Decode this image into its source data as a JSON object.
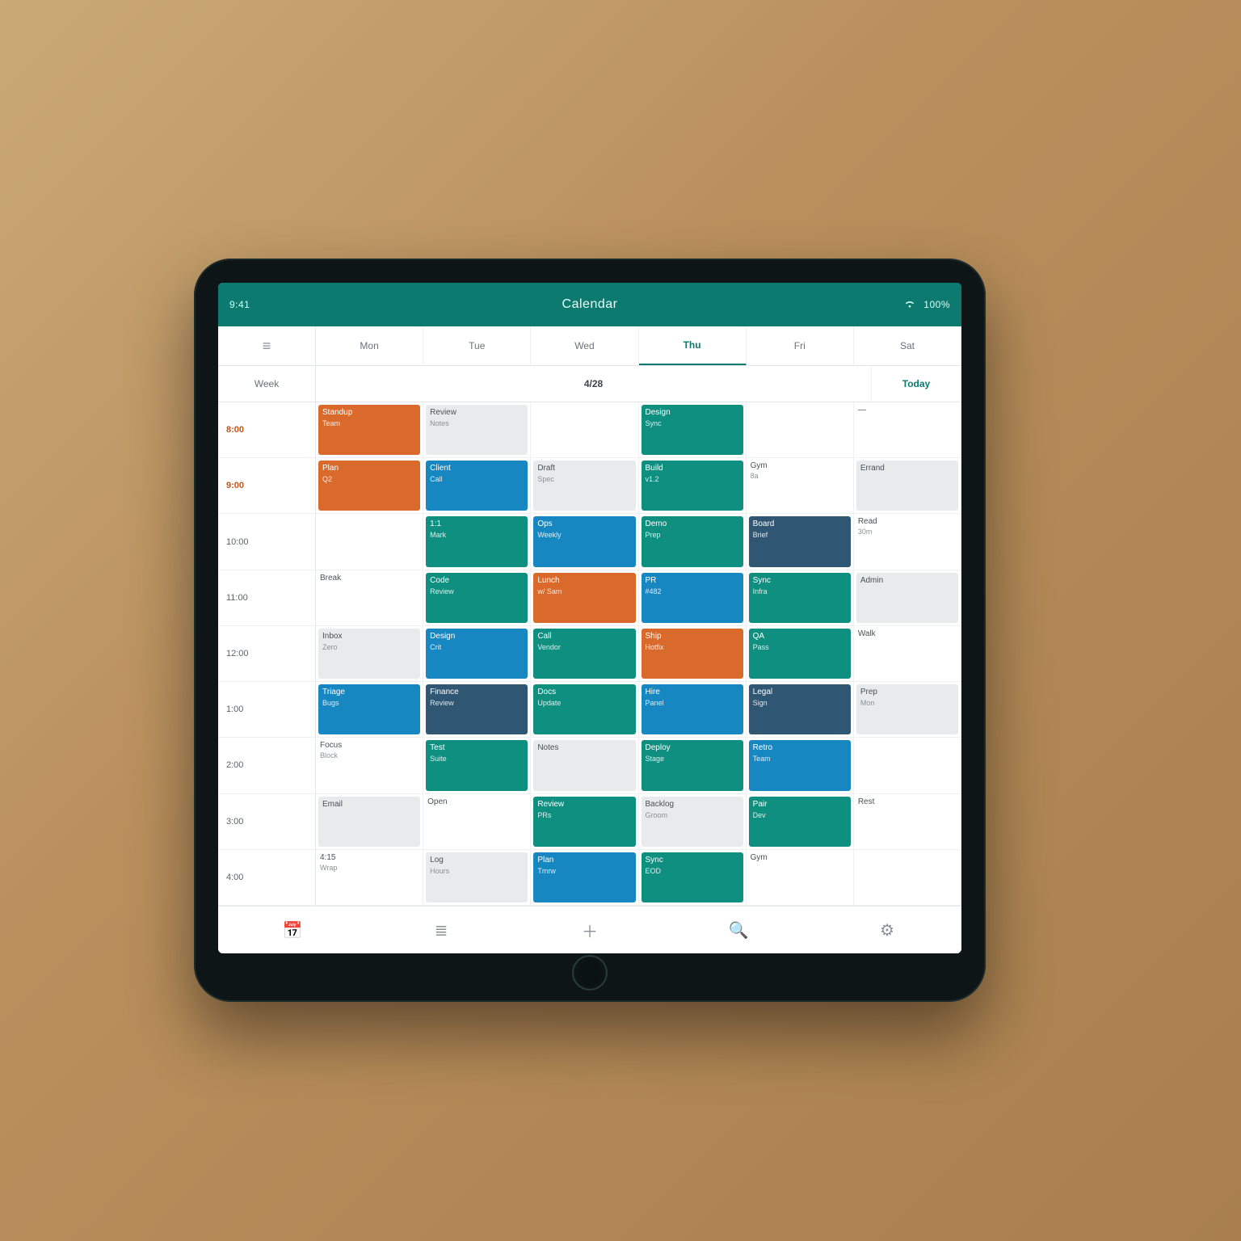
{
  "colors": {
    "teal": "#0f8f7f",
    "blue": "#1787c2",
    "navy": "#2f5672",
    "orange": "#d96a2b",
    "band": "#0c7a6e"
  },
  "titlebar": {
    "title": "Calendar",
    "time": "9:41",
    "battery": "100%"
  },
  "tabs": [
    {
      "label": "Mon"
    },
    {
      "label": "Tue"
    },
    {
      "label": "Wed"
    },
    {
      "label": "Thu"
    },
    {
      "label": "Fri"
    },
    {
      "label": "Sat"
    }
  ],
  "active_tab_index": 3,
  "inforow": {
    "left": "Week",
    "center": "4/28",
    "right": "Today"
  },
  "sidebar": {
    "items": [
      {
        "label": "8:00"
      },
      {
        "label": "9:00"
      },
      {
        "label": "10:00"
      },
      {
        "label": "11:00"
      },
      {
        "label": "12:00"
      },
      {
        "label": "1:00"
      },
      {
        "label": "2:00"
      },
      {
        "label": "3:00"
      },
      {
        "label": "4:00"
      }
    ]
  },
  "grid": {
    "cols": 6,
    "rows": 9,
    "cells": [
      [
        {
          "kind": "ev",
          "tone": "orange",
          "title": "Standup",
          "sub": "Team"
        },
        {
          "kind": "ev",
          "tone": "gray",
          "title": "Review",
          "sub": "Notes"
        },
        {
          "kind": "empty"
        },
        {
          "kind": "ev",
          "tone": "teal",
          "title": "Design",
          "sub": "Sync"
        },
        {
          "kind": "empty"
        },
        {
          "kind": "text",
          "title": "—",
          "sub": ""
        }
      ],
      [
        {
          "kind": "ev",
          "tone": "orange",
          "title": "Plan",
          "sub": "Q2"
        },
        {
          "kind": "ev",
          "tone": "blue",
          "title": "Client",
          "sub": "Call"
        },
        {
          "kind": "ev",
          "tone": "gray",
          "title": "Draft",
          "sub": "Spec"
        },
        {
          "kind": "ev",
          "tone": "teal",
          "title": "Build",
          "sub": "v1.2"
        },
        {
          "kind": "text",
          "title": "Gym",
          "sub": "8a"
        },
        {
          "kind": "ev",
          "tone": "gray",
          "title": "Errand",
          "sub": ""
        }
      ],
      [
        {
          "kind": "empty"
        },
        {
          "kind": "ev",
          "tone": "teal",
          "title": "1:1",
          "sub": "Mark"
        },
        {
          "kind": "ev",
          "tone": "blue",
          "title": "Ops",
          "sub": "Weekly"
        },
        {
          "kind": "ev",
          "tone": "teal",
          "title": "Demo",
          "sub": "Prep"
        },
        {
          "kind": "ev",
          "tone": "navy",
          "title": "Board",
          "sub": "Brief"
        },
        {
          "kind": "text",
          "title": "Read",
          "sub": "30m"
        }
      ],
      [
        {
          "kind": "text",
          "title": "Break",
          "sub": ""
        },
        {
          "kind": "ev",
          "tone": "teal",
          "title": "Code",
          "sub": "Review"
        },
        {
          "kind": "ev",
          "tone": "orange",
          "title": "Lunch",
          "sub": "w/ Sam"
        },
        {
          "kind": "ev",
          "tone": "blue",
          "title": "PR",
          "sub": "#482"
        },
        {
          "kind": "ev",
          "tone": "teal",
          "title": "Sync",
          "sub": "Infra"
        },
        {
          "kind": "ev",
          "tone": "gray",
          "title": "Admin",
          "sub": ""
        }
      ],
      [
        {
          "kind": "ev",
          "tone": "gray",
          "title": "Inbox",
          "sub": "Zero"
        },
        {
          "kind": "ev",
          "tone": "blue",
          "title": "Design",
          "sub": "Crit"
        },
        {
          "kind": "ev",
          "tone": "teal",
          "title": "Call",
          "sub": "Vendor"
        },
        {
          "kind": "ev",
          "tone": "orange",
          "title": "Ship",
          "sub": "Hotfix"
        },
        {
          "kind": "ev",
          "tone": "teal",
          "title": "QA",
          "sub": "Pass"
        },
        {
          "kind": "text",
          "title": "Walk",
          "sub": ""
        }
      ],
      [
        {
          "kind": "ev",
          "tone": "blue",
          "title": "Triage",
          "sub": "Bugs"
        },
        {
          "kind": "ev",
          "tone": "navy",
          "title": "Finance",
          "sub": "Review"
        },
        {
          "kind": "ev",
          "tone": "teal",
          "title": "Docs",
          "sub": "Update"
        },
        {
          "kind": "ev",
          "tone": "blue",
          "title": "Hire",
          "sub": "Panel"
        },
        {
          "kind": "ev",
          "tone": "navy",
          "title": "Legal",
          "sub": "Sign"
        },
        {
          "kind": "ev",
          "tone": "gray",
          "title": "Prep",
          "sub": "Mon"
        }
      ],
      [
        {
          "kind": "text",
          "title": "Focus",
          "sub": "Block"
        },
        {
          "kind": "ev",
          "tone": "teal",
          "title": "Test",
          "sub": "Suite"
        },
        {
          "kind": "ev",
          "tone": "gray",
          "title": "Notes",
          "sub": ""
        },
        {
          "kind": "ev",
          "tone": "teal",
          "title": "Deploy",
          "sub": "Stage"
        },
        {
          "kind": "ev",
          "tone": "blue",
          "title": "Retro",
          "sub": "Team"
        },
        {
          "kind": "empty"
        }
      ],
      [
        {
          "kind": "ev",
          "tone": "gray",
          "title": "Email",
          "sub": ""
        },
        {
          "kind": "text",
          "title": "Open",
          "sub": ""
        },
        {
          "kind": "ev",
          "tone": "teal",
          "title": "Review",
          "sub": "PRs"
        },
        {
          "kind": "ev",
          "tone": "gray",
          "title": "Backlog",
          "sub": "Groom"
        },
        {
          "kind": "ev",
          "tone": "teal",
          "title": "Pair",
          "sub": "Dev"
        },
        {
          "kind": "text",
          "title": "Rest",
          "sub": ""
        }
      ],
      [
        {
          "kind": "text",
          "title": "4:15",
          "sub": "Wrap"
        },
        {
          "kind": "ev",
          "tone": "gray",
          "title": "Log",
          "sub": "Hours"
        },
        {
          "kind": "ev",
          "tone": "blue",
          "title": "Plan",
          "sub": "Tmrw"
        },
        {
          "kind": "ev",
          "tone": "teal",
          "title": "Sync",
          "sub": "EOD"
        },
        {
          "kind": "text",
          "title": "Gym",
          "sub": ""
        },
        {
          "kind": "empty"
        }
      ]
    ]
  },
  "bottombar": {
    "items": [
      {
        "name": "calendar-icon",
        "glyph": "📅"
      },
      {
        "name": "list-icon",
        "glyph": "≣"
      },
      {
        "name": "add-icon",
        "glyph": "＋"
      },
      {
        "name": "search-icon",
        "glyph": "🔍"
      },
      {
        "name": "settings-icon",
        "glyph": "⚙"
      }
    ]
  }
}
